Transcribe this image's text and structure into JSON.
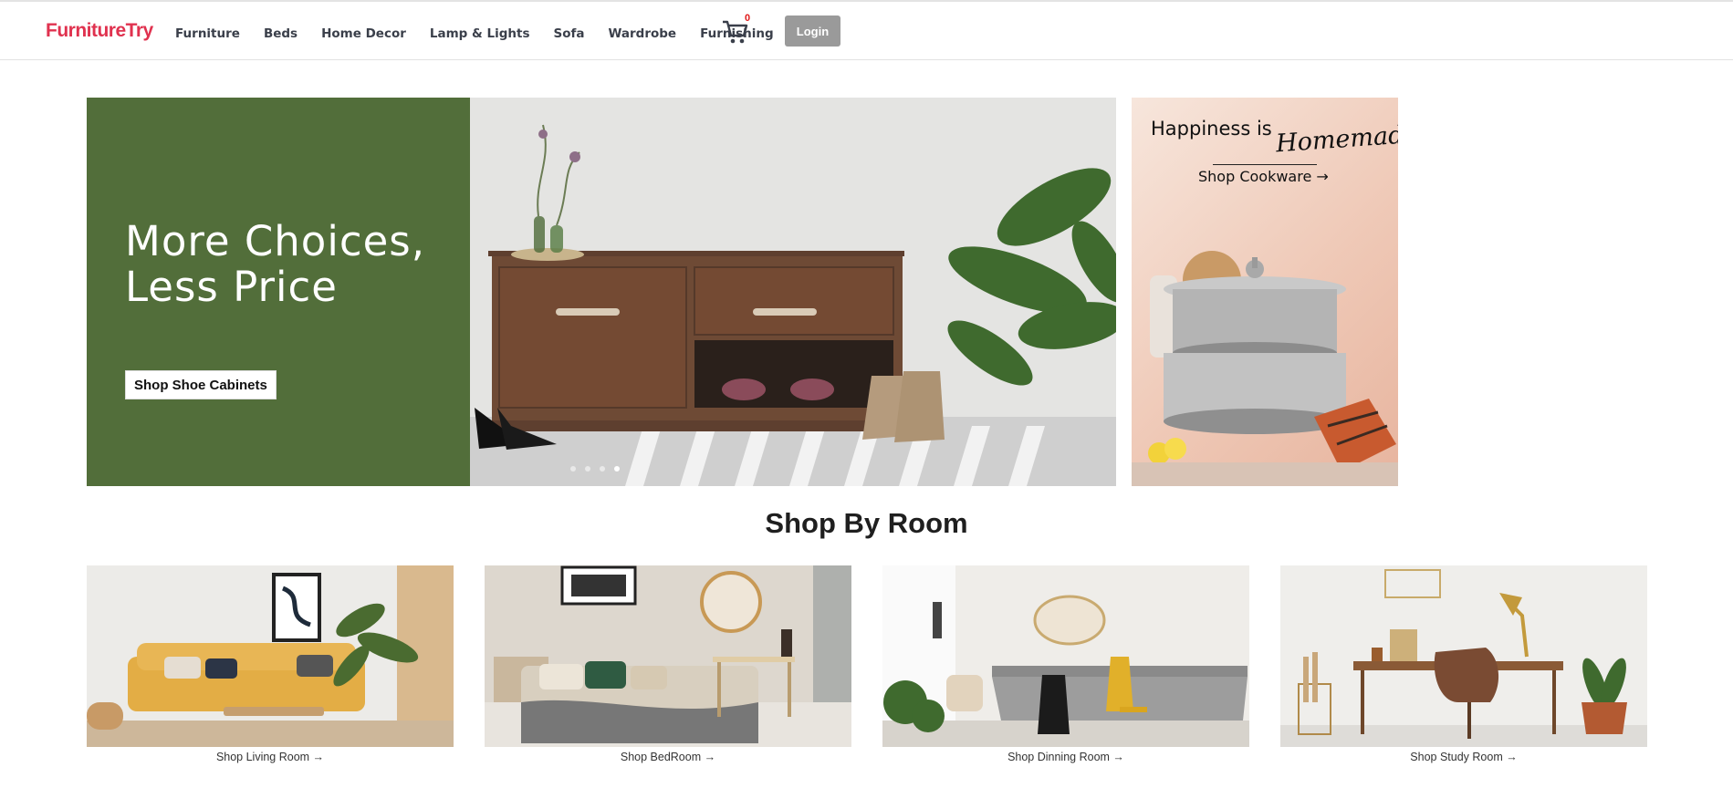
{
  "brand": {
    "name": "FurnitureTry",
    "color": "#e0324f"
  },
  "nav": {
    "items": [
      "Furniture",
      "Beds",
      "Home Decor",
      "Lamp & Lights",
      "Sofa",
      "Wardrobe",
      "Furnishing"
    ],
    "cart_count": "0",
    "login_label": "Login"
  },
  "hero": {
    "title": "More Choices, Less Price",
    "button_label": "Shop Shoe Cabinets",
    "panel_color": "#526e3a",
    "slides": 4,
    "active_slide": 4
  },
  "side_banner": {
    "heading": "Happiness is",
    "script": "Homemade",
    "link_label": "Shop Cookware →"
  },
  "section": {
    "title": "Shop By Room"
  },
  "rooms": [
    {
      "label": "Shop Living Room →"
    },
    {
      "label": "Shop BedRoom →"
    },
    {
      "label": "Shop Dinning Room →"
    },
    {
      "label": "Shop Study Room →"
    }
  ]
}
